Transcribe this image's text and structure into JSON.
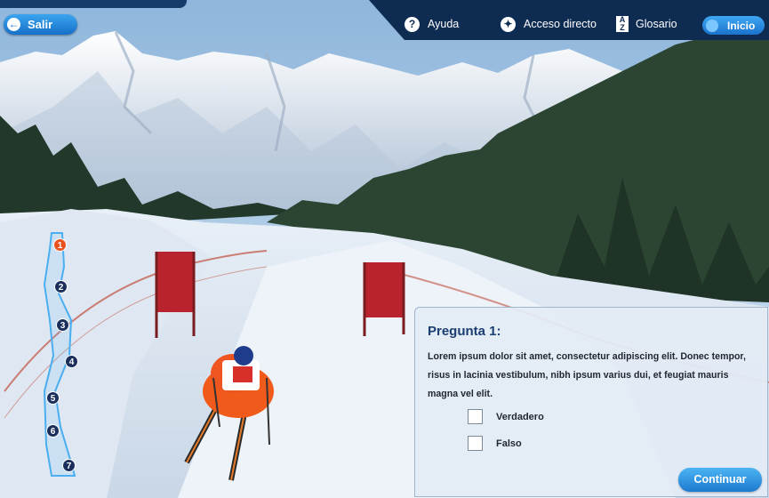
{
  "nav": {
    "back_label": "Salir",
    "help_label": "Ayuda",
    "shortcut_label": "Acceso directo",
    "glossary_label": "Glosario",
    "glossary_icon_text": "A Z",
    "home_label": "Inicio"
  },
  "course": {
    "markers": [
      "1",
      "2",
      "3",
      "4",
      "5",
      "6",
      "7"
    ],
    "active_marker": "1"
  },
  "question": {
    "title": "Pregunta 1:",
    "text": "Lorem ipsum dolor sit amet, consectetur adipiscing elit. Donec tempor, risus in lacinia vestibulum, nibh ipsum varius dui, et feugiat mauris magna vel elit.",
    "options": [
      "Verdadero",
      "Falso"
    ],
    "continue_label": "Continuar"
  },
  "colors": {
    "accent": "#1d7ad0",
    "topbar": "#0e2c52",
    "active_marker": "#e9521f",
    "title": "#1b3e72"
  }
}
